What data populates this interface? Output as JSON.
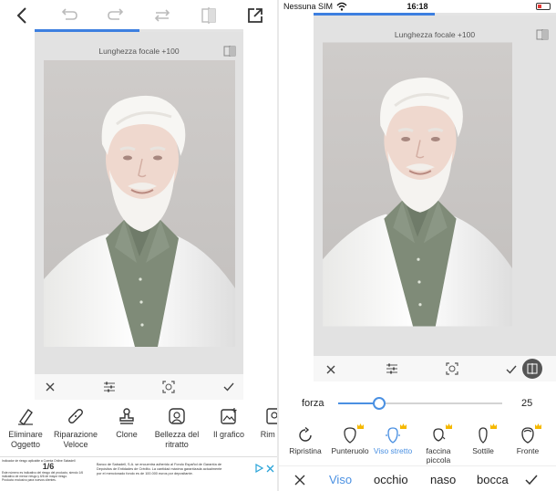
{
  "left": {
    "toolbar": {
      "back_icon": "chevron-left-icon",
      "undo_icon": "undo-icon",
      "redo_icon": "redo-icon",
      "history_icon": "history-icon",
      "compare_icon": "compare-icon",
      "export_icon": "export-icon"
    },
    "progress_fraction": 0.5,
    "canvas": {
      "title": "Lunghezza focale +100"
    },
    "tools": [
      {
        "label": "Eliminare Oggetto",
        "icon": "eraser-icon"
      },
      {
        "label": "Riparazione Veloce",
        "icon": "bandage-icon"
      },
      {
        "label": "Clone",
        "icon": "stamp-icon"
      },
      {
        "label": "Bellezza del ritratto",
        "icon": "portrait-beauty-icon"
      },
      {
        "label": "Il grafico",
        "icon": "image-graphic-icon"
      },
      {
        "label": "Rim sfo",
        "icon": "background-remove-icon"
      }
    ],
    "ad": {
      "left_header": "Indicador de riesgo aplicable a Cuenta Online Sabadell",
      "ratio": "1/6",
      "left_body": "Este número es indicativo del riesgo del producto, siendo 1/6 indicativo de menor riesgo y 6/6 de mayor riesgo.",
      "left_footer": "Producto exclusivo para nuevos clientes.",
      "middle_text": "Banco de Sabadell, S.A. se encuentra adherido al Fondo Español de Garantía de Depósitos de Entidades de Crédito. La cantidad máxima garantizada actualmente por el mencionado fondo es de 100.000 euros por depositante."
    }
  },
  "right": {
    "status": {
      "carrier": "Nessuna SIM",
      "time": "16:18",
      "battery_fraction": 0.3
    },
    "progress_fraction": 0.5,
    "canvas": {
      "title": "Lunghezza focale +100"
    },
    "force": {
      "label": "forza",
      "value": "25",
      "fraction": 0.25
    },
    "face_tools": [
      {
        "label": "Ripristina",
        "icon": "reset-icon",
        "premium": false,
        "active": false
      },
      {
        "label": "Punteruolo",
        "icon": "face-awl-icon",
        "premium": true,
        "active": false
      },
      {
        "label": "Viso stretto",
        "icon": "face-narrow-icon",
        "premium": true,
        "active": true
      },
      {
        "label": "faccina piccola",
        "icon": "face-small-icon",
        "premium": true,
        "active": false
      },
      {
        "label": "Sottile",
        "icon": "face-thin-icon",
        "premium": true,
        "active": false
      },
      {
        "label": "Fronte",
        "icon": "forehead-icon",
        "premium": true,
        "active": false
      }
    ],
    "tabs": [
      {
        "label": "Viso",
        "active": true
      },
      {
        "label": "occhio",
        "active": false
      },
      {
        "label": "naso",
        "active": false
      },
      {
        "label": "bocca",
        "active": false
      }
    ]
  },
  "colors": {
    "accent": "#4a90e2",
    "progress": "#3d7fe0",
    "crown": "#f5b800",
    "canvas_bg": "#e2e2e2"
  }
}
